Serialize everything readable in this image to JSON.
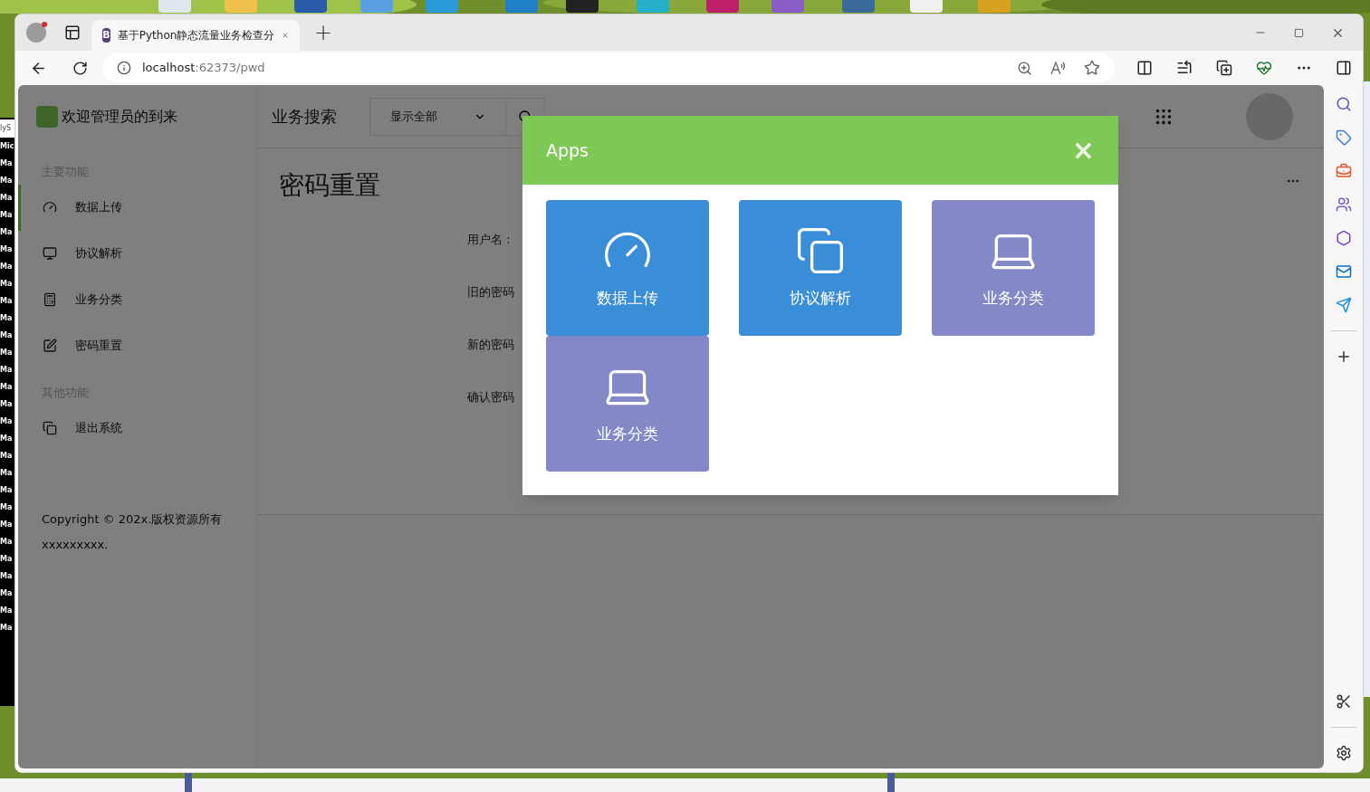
{
  "background_window": {
    "lines": [
      "lyS",
      "Mic",
      "Ma",
      "Ma",
      "Ma",
      "Ma",
      "Ma",
      "Ma",
      "Ma",
      "Ma",
      "Ma",
      "Ma",
      "Ma",
      "Ma",
      "Ma",
      "Ma",
      "Ma",
      "Ma",
      "Ma",
      "Ma",
      "Ma",
      "Ma",
      "Ma",
      "Ma",
      "Ma",
      "Ma",
      "Ma",
      "Ma",
      "Ma",
      "Ma"
    ]
  },
  "browser": {
    "tab": {
      "favicon": "B",
      "title": "基于Python静态流量业务检查分",
      "selected": true
    },
    "new_tab": "+",
    "address": {
      "host": "localhost",
      "path": ":62373/pwd"
    }
  },
  "page": {
    "brand": "欢迎管理员的到来",
    "sidebar": {
      "sections": [
        {
          "heading": "主要功能",
          "items": [
            {
              "label": "数据上传",
              "kind": "gauge",
              "selected": true
            },
            {
              "label": "协议解析",
              "kind": "monitor",
              "selected": false
            },
            {
              "label": "业务分类",
              "kind": "calculator",
              "selected": false
            },
            {
              "label": "密码重置",
              "kind": "edit",
              "selected": false
            }
          ]
        },
        {
          "heading": "其他功能",
          "items": [
            {
              "label": "退出系统",
              "kind": "copy",
              "selected": false
            }
          ]
        }
      ]
    },
    "footer": [
      "Copyright © 202x.版权资源所有",
      "xxxxxxxxx."
    ],
    "header": {
      "title": "业务搜索",
      "select": "显示全部"
    },
    "content": {
      "title": "密码重置",
      "form_labels": [
        "用户名：",
        "旧的密码",
        "新的密码",
        "确认密码"
      ]
    }
  },
  "modal": {
    "title": "Apps",
    "close": "×",
    "tiles": [
      {
        "label": "数据上传",
        "kind": "gauge",
        "color": "#3a8ed8"
      },
      {
        "label": "协议解析",
        "kind": "copy",
        "color": "#3a8ed8"
      },
      {
        "label": "业务分类",
        "kind": "laptop",
        "color": "#8389c6"
      },
      {
        "label": "业务分类",
        "kind": "laptop",
        "color": "#8389c6"
      }
    ]
  }
}
